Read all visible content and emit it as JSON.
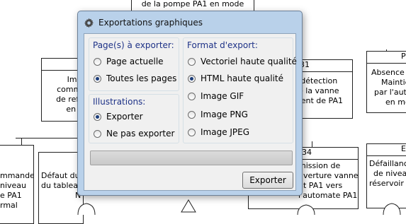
{
  "background": {
    "boxes": [
      {
        "id": "top",
        "lines": [
          "de la pompe PA1 en mode"
        ]
      },
      {
        "id": "left-mid",
        "hdr": "",
        "lines": [
          "Impos",
          "comman",
          "de refoul",
          "en mo"
        ]
      },
      {
        "id": "right-mid",
        "hdr": "31",
        "lines": [
          "e détection",
          "de la vanne",
          "ment de PA1"
        ]
      },
      {
        "id": "far-right-top",
        "hdr": "P",
        "lines": [
          "Absence c",
          "Maintie",
          "par l'aut",
          "en mo"
        ]
      },
      {
        "id": "left-bottom",
        "lines": [
          "mmande",
          "niveau",
          "e PA1",
          "rmal"
        ]
      },
      {
        "id": "mid-bottom",
        "lines": [
          "Défaut du",
          "du tablea",
          "N"
        ]
      },
      {
        "id": "right-bottom",
        "hdr": "34",
        "lines": [
          "mission de",
          "uverture vanne",
          "nt PA1 vers",
          "l'automate PA1"
        ]
      },
      {
        "id": "far-right-bottom",
        "hdr": "E",
        "lines": [
          "Défaillance",
          "de niveau",
          "réservoir c"
        ]
      }
    ]
  },
  "dialog": {
    "title": "Exportations graphiques",
    "icon": "gear-icon",
    "pages_group": {
      "title": "Page(s) à exporter:",
      "options": [
        {
          "label": "Page actuelle",
          "selected": false
        },
        {
          "label": "Toutes les pages",
          "selected": true
        }
      ]
    },
    "illustrations_group": {
      "title": "Illustrations:",
      "options": [
        {
          "label": "Exporter",
          "selected": true
        },
        {
          "label": "Ne pas exporter",
          "selected": false
        }
      ]
    },
    "format_group": {
      "title": "Format d'export:",
      "options": [
        {
          "label": "Vectoriel haute qualité",
          "selected": false
        },
        {
          "label": "HTML haute qualité",
          "selected": true
        },
        {
          "label": "Image GIF",
          "selected": false
        },
        {
          "label": "Image PNG",
          "selected": false
        },
        {
          "label": "Image JPEG",
          "selected": false
        }
      ]
    },
    "export_button": "Exporter"
  },
  "colors": {
    "frame": "#b9d1ea",
    "group_title": "#1e3287",
    "radio_dot": "#1c3d7a",
    "alert_header": "#cc2222"
  }
}
